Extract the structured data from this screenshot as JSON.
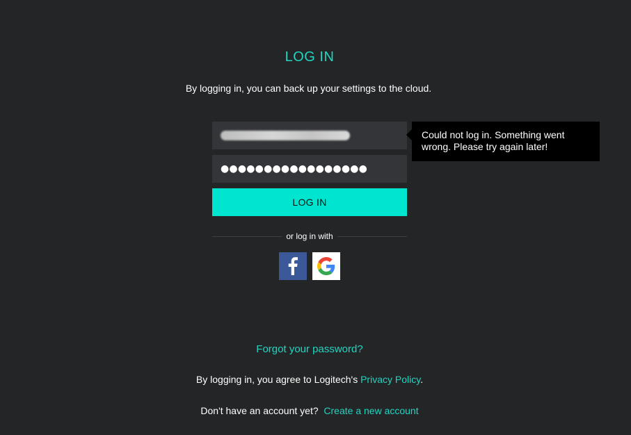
{
  "header": {
    "title": "LOG IN",
    "subtitle": "By logging in, you can back up your settings to the cloud."
  },
  "form": {
    "email_value": "(redacted email)",
    "password_mask": "●●●●●●●●●●●●●●●●●",
    "login_button_label": "LOG IN",
    "divider_text": "or log in with"
  },
  "social": [
    {
      "name": "facebook",
      "icon": "facebook-icon",
      "color": "#3b5998"
    },
    {
      "name": "google",
      "icon": "google-icon",
      "color": "#ffffff"
    }
  ],
  "error": {
    "message": "Could not log in. Something went wrong. Please try again later!"
  },
  "footer": {
    "forgot_password": "Forgot your password?",
    "agree_prefix": "By logging in, you agree to Logitech's",
    "privacy_link": "Privacy Policy",
    "agree_suffix": ".",
    "no_account_prefix": "Don't have an account yet?",
    "create_account_link": "Create a new account"
  },
  "colors": {
    "background": "#242527",
    "accent": "#1fd6c3",
    "button": "#00e5cf",
    "field": "#333538",
    "tooltip": "#000000"
  }
}
